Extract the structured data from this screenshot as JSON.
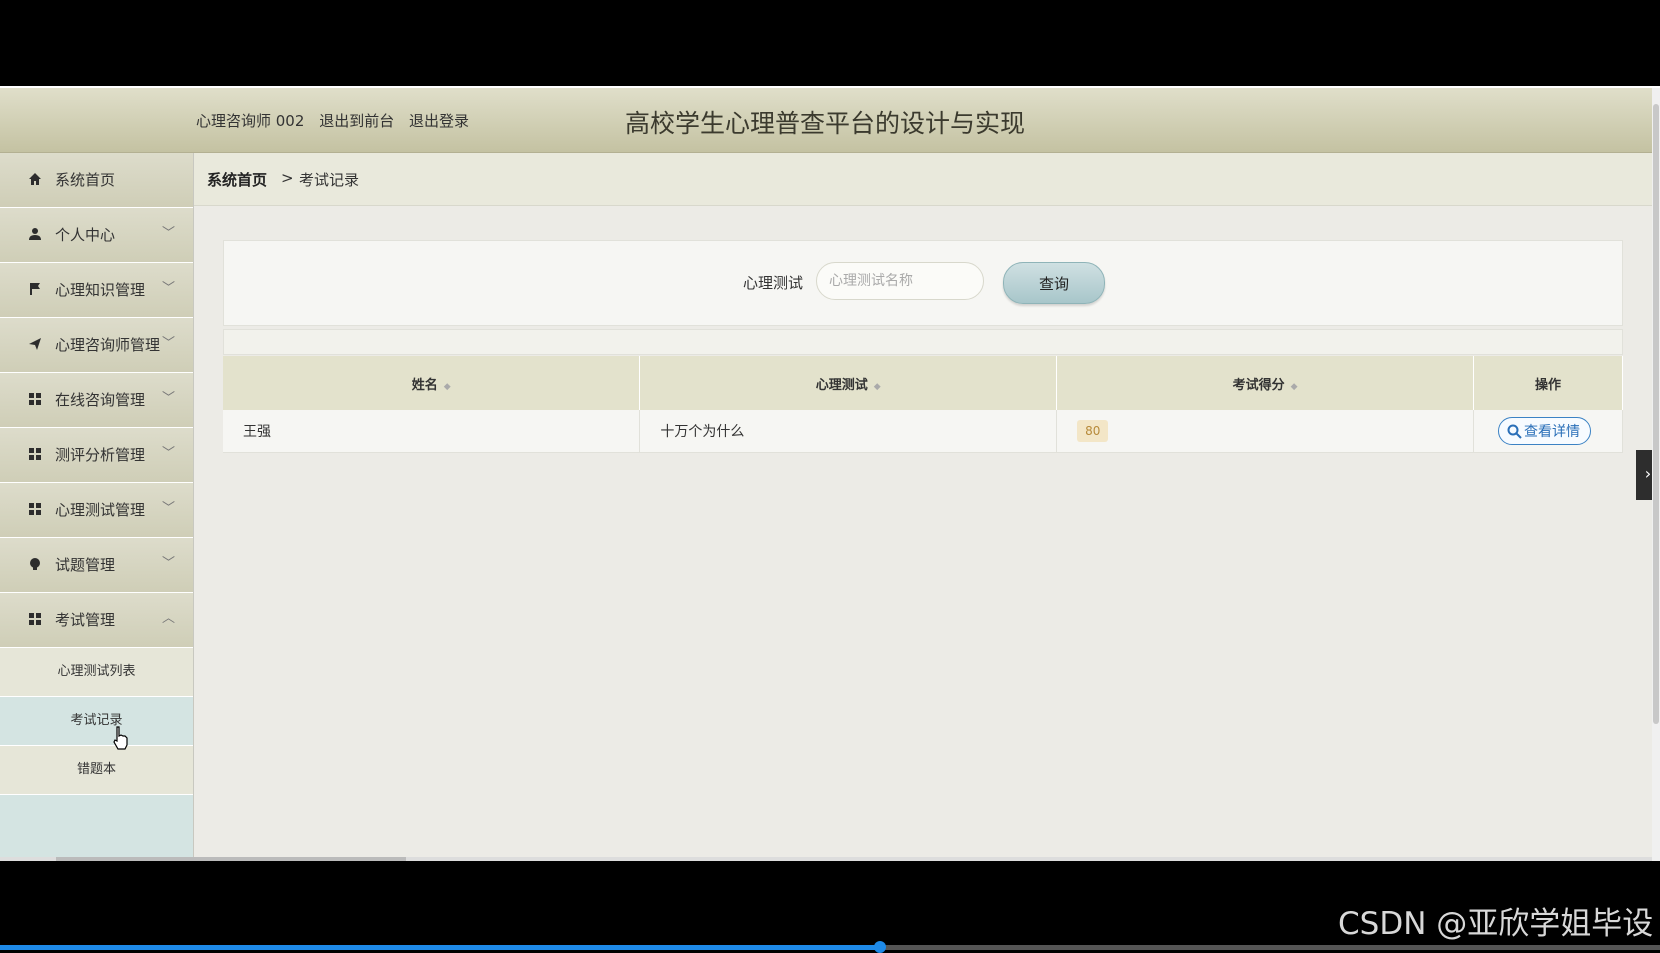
{
  "header": {
    "user": "心理咨询师 002",
    "back_to_front": "退出到前台",
    "logout": "退出登录",
    "site_title": "高校学生心理普查平台的设计与实现"
  },
  "sidebar": {
    "items": [
      {
        "label": "系统首页",
        "icon": "home-icon",
        "chevron": ""
      },
      {
        "label": "个人中心",
        "icon": "user-icon",
        "chevron": "﹀"
      },
      {
        "label": "心理知识管理",
        "icon": "flag-icon",
        "chevron": "﹀"
      },
      {
        "label": "心理咨询师管理",
        "icon": "send-icon",
        "chevron": "﹀"
      },
      {
        "label": "在线咨询管理",
        "icon": "grid-icon",
        "chevron": "﹀"
      },
      {
        "label": "测评分析管理",
        "icon": "grid-icon",
        "chevron": "﹀"
      },
      {
        "label": "心理测试管理",
        "icon": "grid-icon",
        "chevron": "﹀"
      },
      {
        "label": "试题管理",
        "icon": "bulb-icon",
        "chevron": "﹀"
      },
      {
        "label": "考试管理",
        "icon": "grid-icon",
        "chevron": "︿"
      }
    ],
    "sub_items": [
      {
        "label": "心理测试列表"
      },
      {
        "label": "考试记录"
      },
      {
        "label": "错题本"
      }
    ]
  },
  "breadcrumb": {
    "home": "系统首页",
    "separator": ">",
    "current": "考试记录"
  },
  "search": {
    "label": "心理测试",
    "placeholder": "心理测试名称",
    "button": "查询"
  },
  "table": {
    "headers": [
      "姓名",
      "心理测试",
      "考试得分",
      "操作"
    ],
    "rows": [
      {
        "name": "王强",
        "test": "十万个为什么",
        "score": "80",
        "action": "查看详情"
      }
    ]
  },
  "side_tab": "›",
  "watermark": "CSDN @亚欣学姐毕设",
  "video_progress": 0.53,
  "colors": {
    "header": "#c4c2a2",
    "sidebar": "#cfceb7",
    "active_submenu": "#d4e4e2",
    "link_blue": "#2a6fb8",
    "progress": "#1e8ae8"
  }
}
